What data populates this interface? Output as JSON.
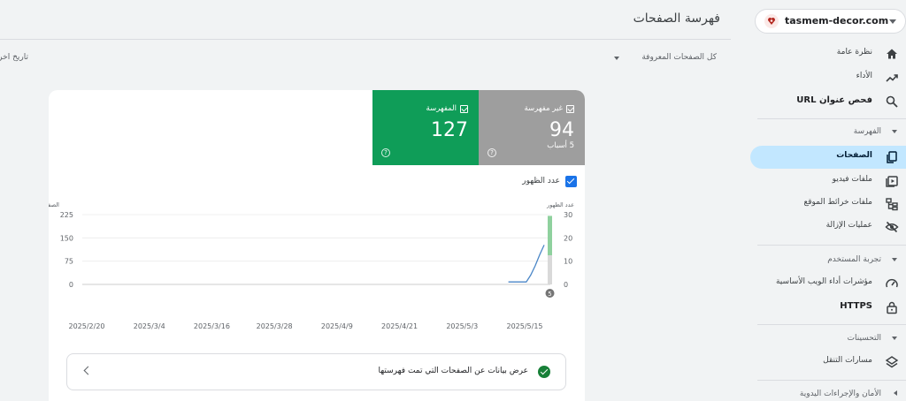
{
  "property": {
    "name": "tasmem-decor.com"
  },
  "header": {
    "title": "فهرسة الصفحات",
    "filter": "كل الصفحات المعروفة",
    "date_label": "تاريخ آخر تحديث"
  },
  "sidebar": {
    "items_top": [
      {
        "label": "نظرة عامة",
        "icon": "home-icon"
      },
      {
        "label": "الأداء",
        "icon": "trending-up-icon"
      },
      {
        "label": "فحص عنوان URL",
        "icon": "search-icon"
      }
    ],
    "section_indexing": "الفهرسة",
    "items_indexing": [
      {
        "label": "الصفحات",
        "icon": "pages-icon"
      },
      {
        "label": "ملفات فيديو",
        "icon": "video-icon"
      },
      {
        "label": "ملفات خرائط الموقع",
        "icon": "sitemap-icon"
      },
      {
        "label": "عمليات الإزالة",
        "icon": "eye-off-icon"
      }
    ],
    "section_experience": "تجربة المستخدم",
    "items_experience": [
      {
        "label": "مؤشرات أداء الويب الأساسية",
        "icon": "gauge-icon"
      },
      {
        "label": "HTTPS",
        "icon": "lock-icon"
      }
    ],
    "section_enhancements": "التحسينات",
    "items_enhancements": [
      {
        "label": "مسارات التنقل",
        "icon": "layers-icon"
      }
    ],
    "section_security": "الأمان والإجراءات اليدوية"
  },
  "tiles": {
    "not_indexed": {
      "label": "غير مفهرسة",
      "value": "94",
      "sub": "5 أسباب",
      "color": "#9e9e9e"
    },
    "indexed": {
      "label": "المفهرسة",
      "value": "127",
      "color": "#0f9d58"
    }
  },
  "impressions_toggle": {
    "label": "عدد الظهور"
  },
  "chart_data": {
    "type": "line",
    "left_axis": {
      "label": "الصفحات",
      "ticks": [
        0,
        75,
        150,
        225
      ],
      "ylim": [
        0,
        225
      ]
    },
    "right_axis": {
      "label": "عدد الظهور",
      "ticks": [
        0,
        10,
        20,
        30
      ],
      "ylim": [
        0,
        30
      ]
    },
    "x_ticks": [
      "2025/2/20",
      "2025/3/4",
      "2025/3/16",
      "2025/3/28",
      "2025/4/9",
      "2025/4/21",
      "2025/5/3",
      "2025/5/15"
    ],
    "series": [
      {
        "color": "#4a86c7",
        "values": [
          0,
          0,
          0,
          0,
          0,
          0,
          0,
          0,
          0,
          0,
          0,
          0,
          0,
          0,
          0,
          0,
          0,
          0,
          0,
          0,
          0,
          0,
          0,
          0,
          0,
          0,
          0,
          0,
          0,
          0,
          0,
          0,
          0,
          0,
          0,
          0,
          0,
          0,
          0,
          0,
          0,
          0,
          0,
          0,
          0,
          0,
          0,
          0,
          0,
          0,
          0,
          0,
          0,
          0,
          0,
          0,
          0,
          0,
          0,
          0,
          0,
          0,
          0,
          0,
          0,
          0,
          0,
          0,
          0,
          0,
          0,
          0,
          0,
          0,
          0,
          0,
          0,
          0,
          0,
          0,
          0,
          0,
          0,
          0,
          0,
          0,
          0,
          0,
          0,
          0,
          0,
          0,
          8,
          8,
          8,
          8,
          30,
          60,
          95,
          127
        ]
      }
    ],
    "bars": {
      "indexed_color": "#8fd19e",
      "not_indexed_color": "#d9d9d9",
      "indexed": 127,
      "not_indexed": 94
    },
    "annotation": "5",
    "grid": true
  },
  "detail_row": {
    "label": "عرض بيانات عن الصفحات التي تمت فهرستها"
  }
}
